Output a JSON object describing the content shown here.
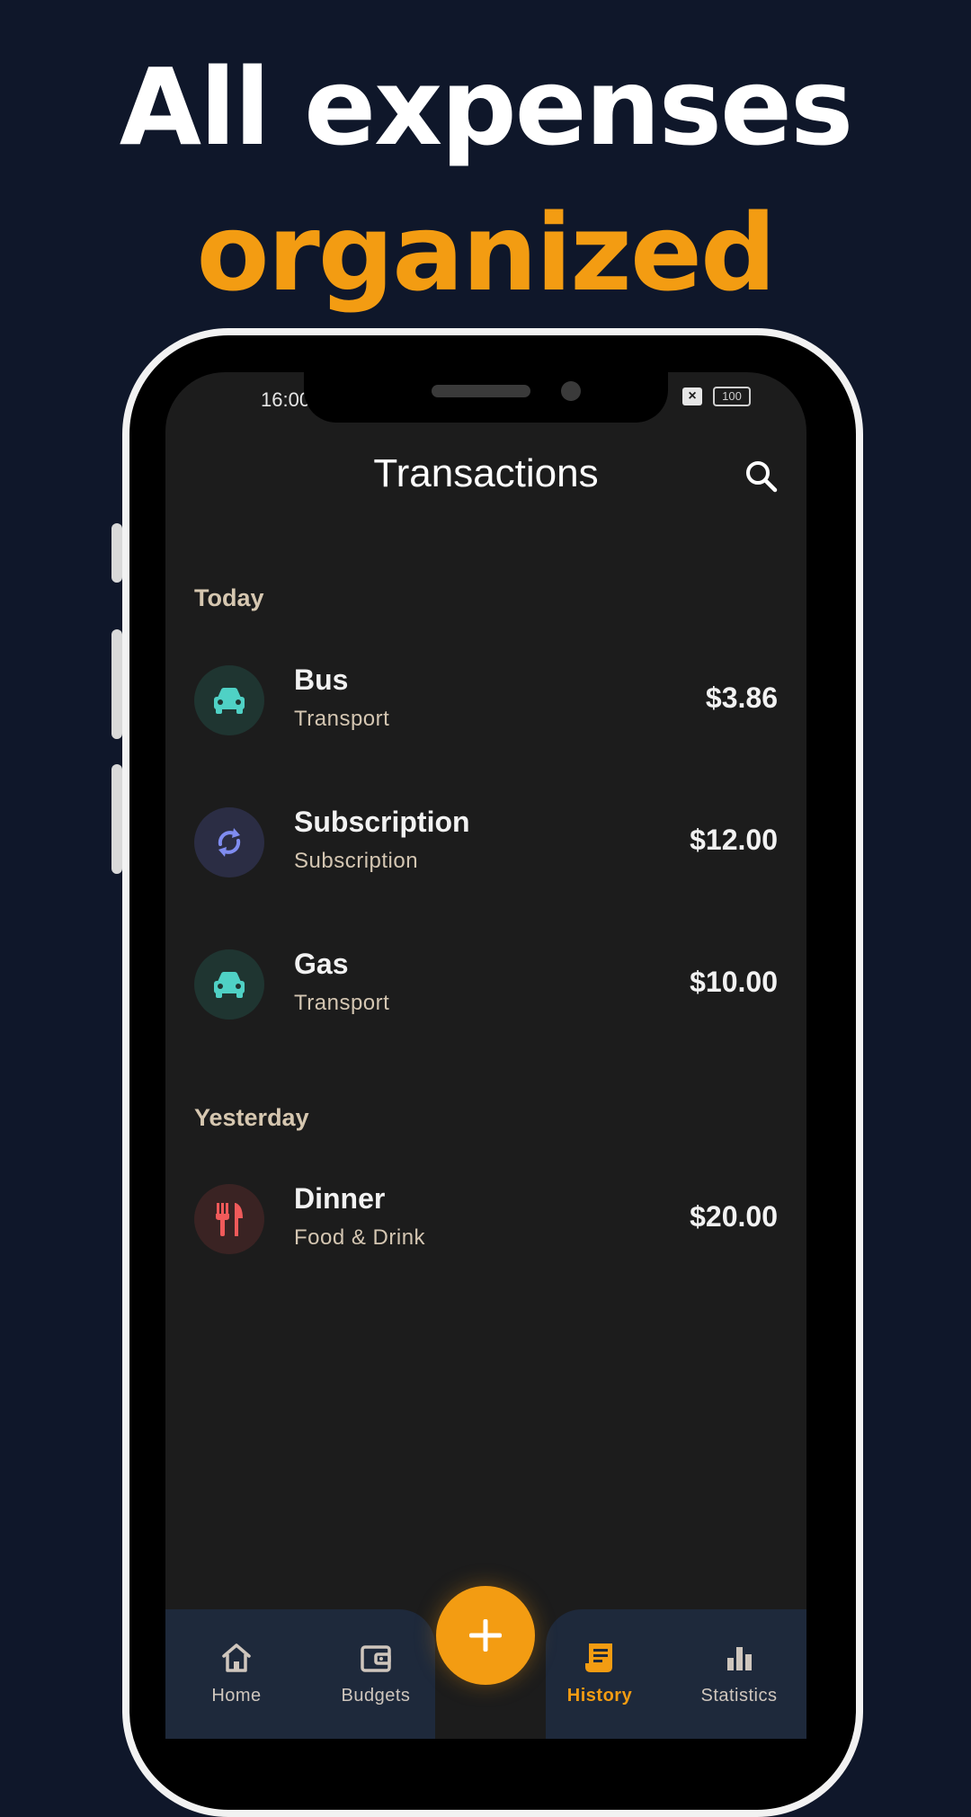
{
  "headline": {
    "line1": "All expenses",
    "line2": "organized"
  },
  "status_bar": {
    "time": "16:00",
    "battery": "100"
  },
  "app": {
    "title": "Transactions"
  },
  "sections": [
    {
      "label": "Today",
      "transactions": [
        {
          "name": "Bus",
          "category": "Transport",
          "amount": "$3.86",
          "icon": "car-icon"
        },
        {
          "name": "Subscription",
          "category": "Subscription",
          "amount": "$12.00",
          "icon": "refresh-icon"
        },
        {
          "name": "Gas",
          "category": "Transport",
          "amount": "$10.00",
          "icon": "car-icon"
        }
      ]
    },
    {
      "label": "Yesterday",
      "transactions": [
        {
          "name": "Dinner",
          "category": "Food & Drink",
          "amount": "$20.00",
          "icon": "utensils-icon"
        }
      ]
    }
  ],
  "nav": {
    "items": [
      {
        "label": "Home",
        "icon": "home-icon"
      },
      {
        "label": "Budgets",
        "icon": "wallet-icon"
      },
      {
        "label": "History",
        "icon": "receipt-icon",
        "active": true
      },
      {
        "label": "Statistics",
        "icon": "bar-chart-icon"
      }
    ],
    "fab_icon": "plus-icon"
  },
  "colors": {
    "background": "#0f172a",
    "accent": "#f39c12",
    "transport": "#4fd1c5",
    "subscription": "#7f8cf0",
    "food": "#f05a5a"
  }
}
